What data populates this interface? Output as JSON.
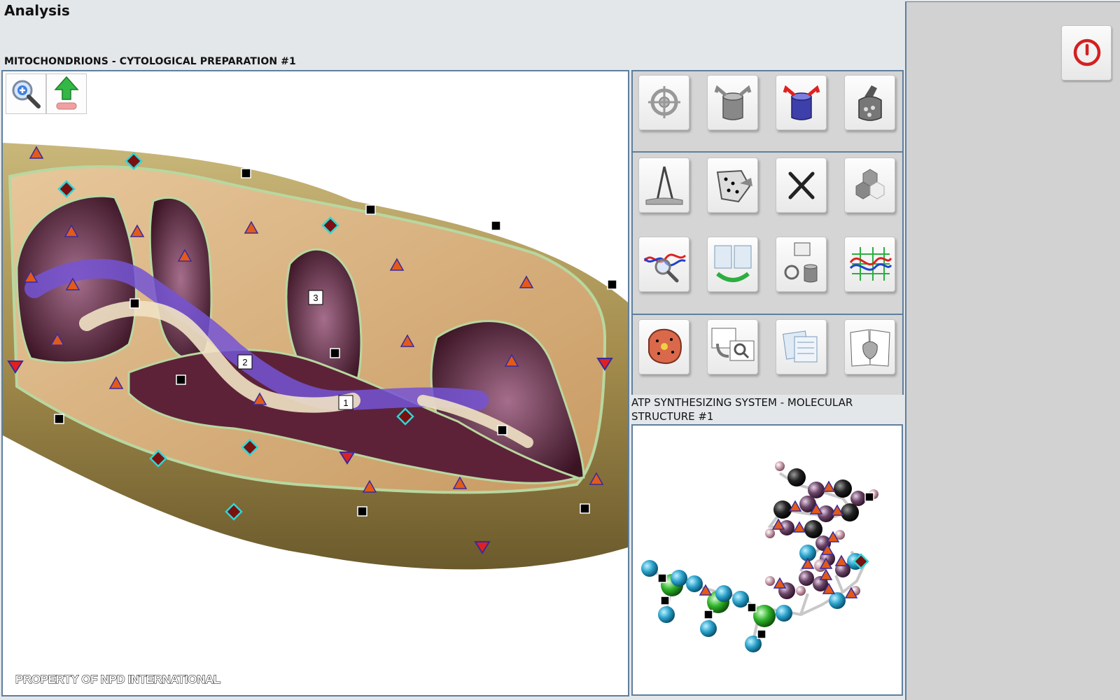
{
  "app": {
    "title": "Analysis"
  },
  "preparation": {
    "title": "MITOCHONDRIONS - CYTOLOGICAL PREPARATION #1",
    "copyright": "PROPERTY OF NPD INTERNATIONAL",
    "labels": [
      "1",
      "2",
      "3"
    ],
    "tools": [
      "zoom-in-icon",
      "export-up-icon"
    ]
  },
  "toolbar": {
    "row1": [
      "target-crosshair-icon",
      "cylinder-expand-icon",
      "cylinder-red-arrows-icon",
      "tissue-sample-icon"
    ],
    "row2": [
      "measure-compass-icon",
      "dotted-shape-icon",
      "close-x-icon",
      "hexagon-cells-icon"
    ],
    "row3": [
      "wave-magnifier-icon",
      "clipboard-exchange-icon",
      "components-cylinder-icon",
      "graph-lines-icon"
    ],
    "row4": [
      "cell-tissue-icon",
      "search-rotate-icon",
      "documents-icon",
      "anatomy-book-icon"
    ]
  },
  "molecule": {
    "title": "ATP SYNTHESIZING SYSTEM - MOLECULAR STRUCTURE #1"
  },
  "colors": {
    "border": "#5e7f9e",
    "power": "#d42020",
    "triangle": "#e35a18",
    "marker_outline": "#3a2a9c",
    "diamond": "#7a1010",
    "diamond_outline": "#2ed6d6"
  }
}
